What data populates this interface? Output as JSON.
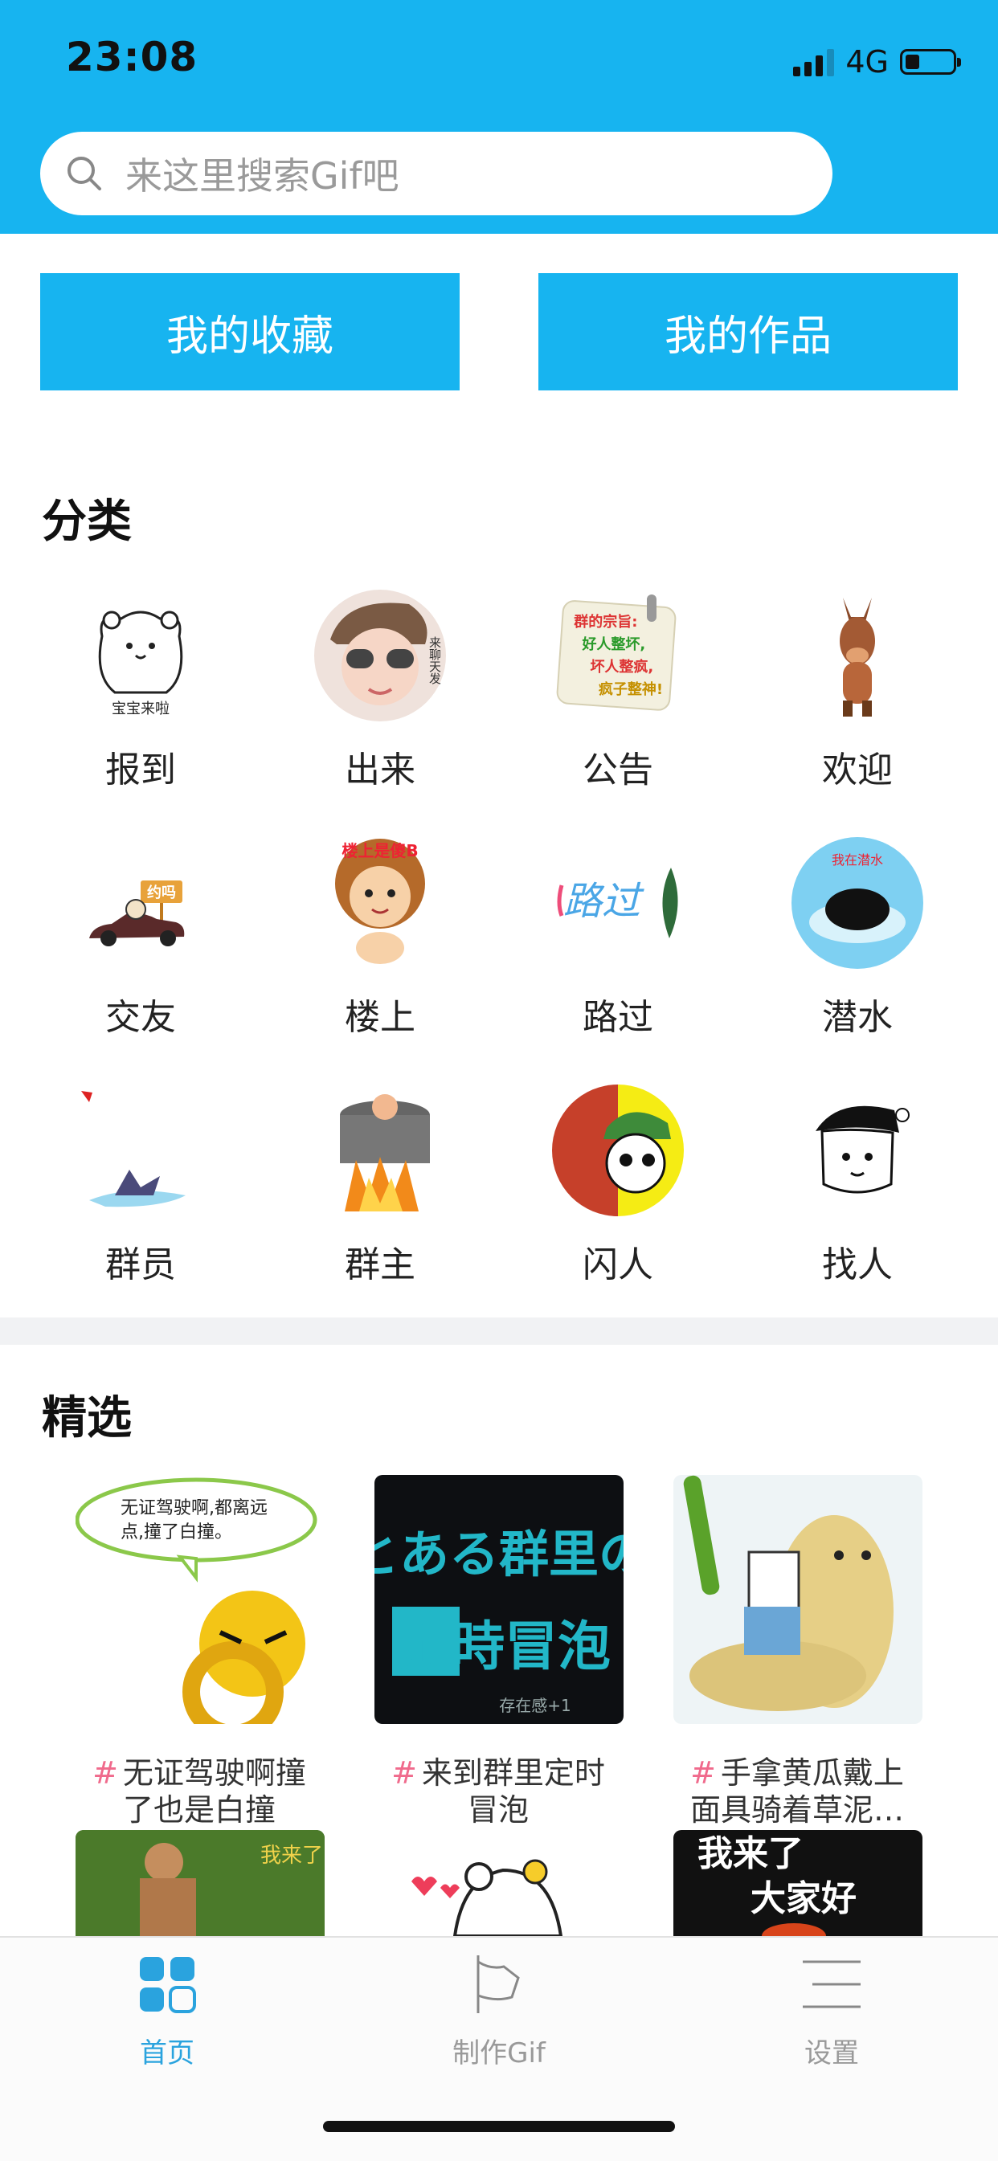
{
  "status": {
    "time": "23:08",
    "network": "4G",
    "battery_level": 0.3
  },
  "search": {
    "placeholder": "来这里搜索Gif吧"
  },
  "buttons": {
    "favorites": "我的收藏",
    "works": "我的作品"
  },
  "categories": {
    "title": "分类",
    "items": [
      {
        "label": "报到",
        "icon": "bear-icon"
      },
      {
        "label": "出来",
        "icon": "baby-icon"
      },
      {
        "label": "公告",
        "icon": "notice-icon"
      },
      {
        "label": "欢迎",
        "icon": "horse-icon"
      },
      {
        "label": "交友",
        "icon": "car-icon"
      },
      {
        "label": "楼上",
        "icon": "curly-kid-icon"
      },
      {
        "label": "路过",
        "icon": "passby-icon"
      },
      {
        "label": "潜水",
        "icon": "dive-icon"
      },
      {
        "label": "群员",
        "icon": "shark-icon"
      },
      {
        "label": "群主",
        "icon": "fire-pot-icon"
      },
      {
        "label": "闪人",
        "icon": "soldier-icon"
      },
      {
        "label": "找人",
        "icon": "kid-hat-icon"
      }
    ],
    "image_text": {
      "bear": "宝宝来啦",
      "baby": "来聊天发",
      "notice": [
        "群的宗旨:",
        "好人整坏,",
        "坏人整疯,",
        "疯子整神!"
      ],
      "car": "约吗",
      "curly": "楼上是傻B",
      "passby": "路过",
      "dive": "我在潜水"
    }
  },
  "featured": {
    "title": "精选",
    "items": [
      {
        "caption_line1": "无证驾驶啊撞",
        "caption_line2": "了也是白撞"
      },
      {
        "caption_line1": "来到群里定时",
        "caption_line2": "冒泡"
      },
      {
        "caption_line1": "手拿黄瓜戴上",
        "caption_line2": "面具骑着草泥…"
      }
    ],
    "image_text": {
      "bubble": [
        "无证驾驶啊,都离远",
        "点,撞了白撞。"
      ],
      "bubble_title": [
        "とある群里の",
        "定時冒泡"
      ],
      "bubble_sub": "存在感+1",
      "next_left": "我来了",
      "next_right": [
        "我来了",
        "大家好"
      ]
    },
    "hash": "#"
  },
  "tabbar": {
    "items": [
      {
        "label": "首页",
        "icon": "home-grid-icon",
        "active": true
      },
      {
        "label": "制作Gif",
        "icon": "flag-icon",
        "active": false
      },
      {
        "label": "设置",
        "icon": "menu-icon",
        "active": false
      }
    ]
  },
  "colors": {
    "accent": "#17b4f0",
    "tab_active": "#2aa3de",
    "tab_inactive": "#999999",
    "hash": "#f06a8c"
  }
}
